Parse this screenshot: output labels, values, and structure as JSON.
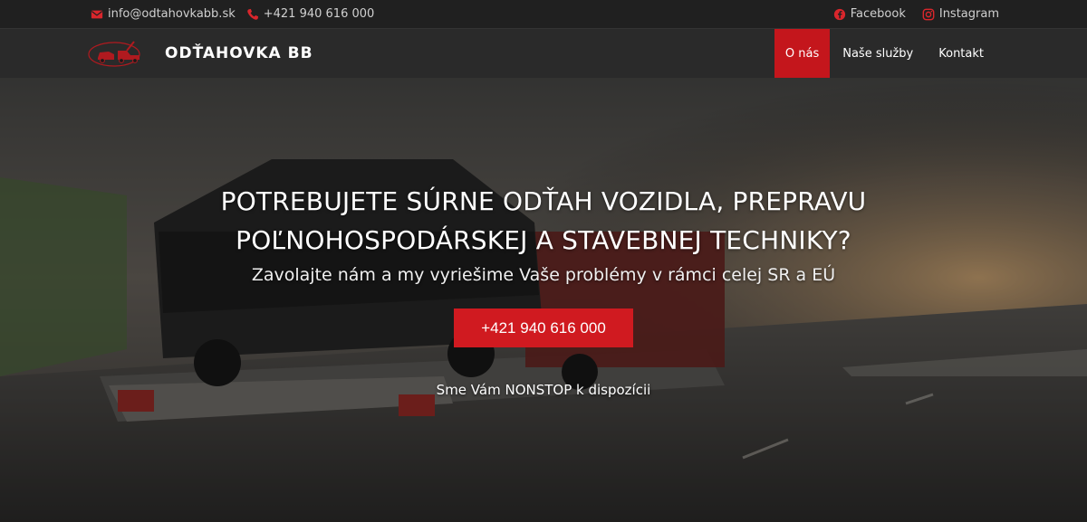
{
  "topbar": {
    "email": "info@odtahovkabb.sk",
    "phone": "+421 940 616 000",
    "facebook": "Facebook",
    "instagram": "Instagram"
  },
  "nav": {
    "brand": "ODŤAHOVKA BB",
    "items": [
      {
        "label": "O nás",
        "active": true
      },
      {
        "label": "Naše služby",
        "active": false
      },
      {
        "label": "Kontakt",
        "active": false
      }
    ]
  },
  "hero": {
    "headline_line1": "POTREBUJETE SÚRNE ODŤAH VOZIDLA, PREPRAVU",
    "headline_line2": "POĽNOHOSPODÁRSKEJ A STAVEBNEJ TECHNIKY?",
    "subtitle": "Zavolajte nám a my vyriešime Vaše problémy v rámci celej SR a EÚ",
    "cta_label": "+421 940 616 000",
    "note": "Sme Vám NONSTOP k dispozícii"
  },
  "colors": {
    "accent": "#c4161c",
    "topbar_bg": "#202020",
    "navbar_bg": "#2a2a2a"
  },
  "icons": [
    "envelope-icon",
    "phone-icon",
    "facebook-icon",
    "instagram-icon",
    "tow-truck-logo"
  ]
}
